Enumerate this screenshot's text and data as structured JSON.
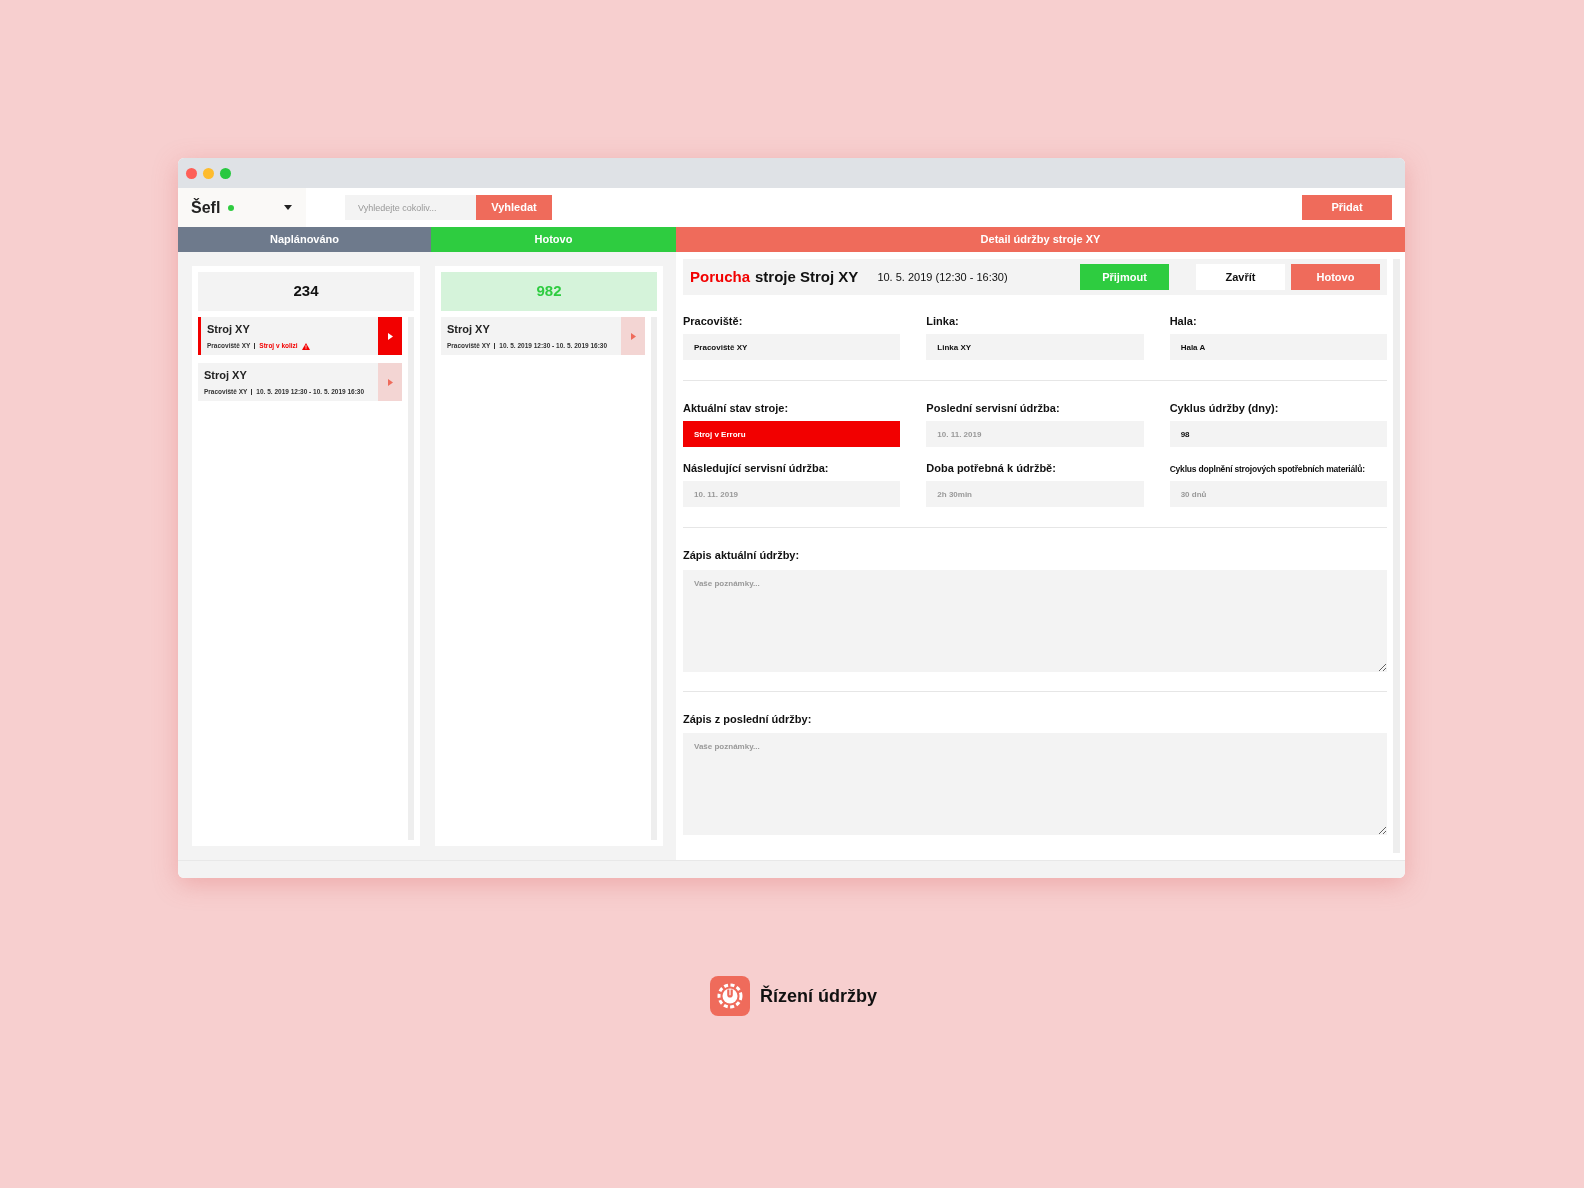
{
  "topbar": {
    "user": "Šefl",
    "online": true,
    "search": {
      "placeholder": "Vyhledejte cokoliv...",
      "button": "Vyhledat"
    },
    "add_button": "Přidat"
  },
  "columns": [
    {
      "title": "Naplánováno",
      "kind": "planned",
      "count": "234",
      "cards": [
        {
          "title": "Stroj XY",
          "workplace": "Pracoviště XY",
          "detail": "Stroj v kolizi",
          "alert": true
        },
        {
          "title": "Stroj XY",
          "workplace": "Pracoviště XY",
          "detail": "10. 5. 2019 12:30 - 10. 5. 2019 16:30",
          "alert": false
        }
      ]
    },
    {
      "title": "Hotovo",
      "kind": "done",
      "count": "982",
      "cards": [
        {
          "title": "Stroj XY",
          "workplace": "Pracoviště XY",
          "detail": "10. 5. 2019 12:30 - 10. 5. 2019 16:30",
          "alert": false
        }
      ]
    }
  ],
  "detail": {
    "header": "Detail údržby stroje XY",
    "title_prefix": "Porucha",
    "title": "stroje Stroj XY",
    "date": "10. 5. 2019 (12:30 - 16:30)",
    "buttons": [
      {
        "label": "Přijmout",
        "kind": "accept"
      },
      {
        "label": "Zavřít",
        "kind": "close"
      },
      {
        "label": "Hotovo",
        "kind": "done"
      }
    ],
    "sections": [
      [
        {
          "label": "Pracoviště:",
          "value": "Pracoviště XY",
          "kind": "text",
          "disabled": false
        },
        {
          "label": "Linka:",
          "value": "Linka XY",
          "kind": "text",
          "disabled": false
        },
        {
          "label": "Hala:",
          "value": "Hala A",
          "kind": "text",
          "disabled": false
        }
      ],
      [
        {
          "label": "Aktuální stav stroje:",
          "value": "Stroj v Erroru",
          "kind": "status"
        },
        {
          "label": "Poslední servisní údržba:",
          "value": "10. 11. 2019",
          "kind": "text",
          "disabled": true
        },
        {
          "label": "Cyklus údržby (dny):",
          "value": "98",
          "kind": "text",
          "disabled": false
        },
        {
          "label": "Následující servisní údržba:",
          "value": "10. 11. 2019",
          "kind": "text",
          "disabled": true
        },
        {
          "label": "Doba potřebná k údržbě:",
          "value": "2h 30min",
          "kind": "text",
          "disabled": true
        },
        {
          "label": "Cyklus doplnění strojových spotřebních materiálů:",
          "value": "30 dnů",
          "kind": "text",
          "disabled": true
        }
      ]
    ],
    "notes": [
      {
        "label": "Zápis aktuální údržby:",
        "placeholder": "Vaše poznámky..."
      },
      {
        "label": "Zápis z poslední údržby:",
        "placeholder": "Vaše poznámky..."
      }
    ]
  },
  "brand": {
    "name": "Řízení údržby"
  }
}
